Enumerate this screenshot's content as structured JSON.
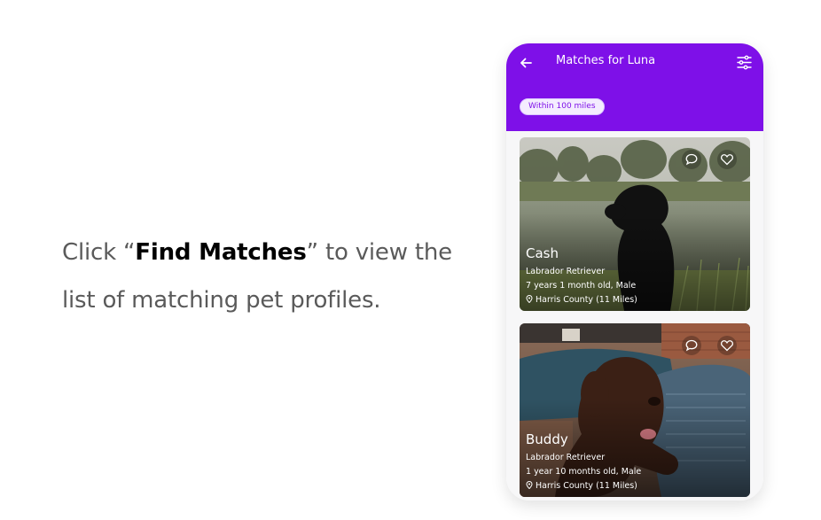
{
  "instruction": {
    "before": "Click “",
    "highlight": "Find Matches",
    "after": "” to view the list of matching pet profiles."
  },
  "app": {
    "title": "Matches for Luna",
    "filter_chip": "Within 100 miles",
    "accent_color": "#7e10e8",
    "back_icon": "arrow-left-icon",
    "filter_icon": "sliders-icon"
  },
  "pets": [
    {
      "name": "Cash",
      "breed": "Labrador Retriever",
      "age": "7 years 1 month old, Male",
      "location": "Harris County (11 Miles)"
    },
    {
      "name": "Buddy",
      "breed": "Labrador Retriever",
      "age": "1 year 10 months old, Male",
      "location": "Harris County (11 Miles)"
    }
  ]
}
